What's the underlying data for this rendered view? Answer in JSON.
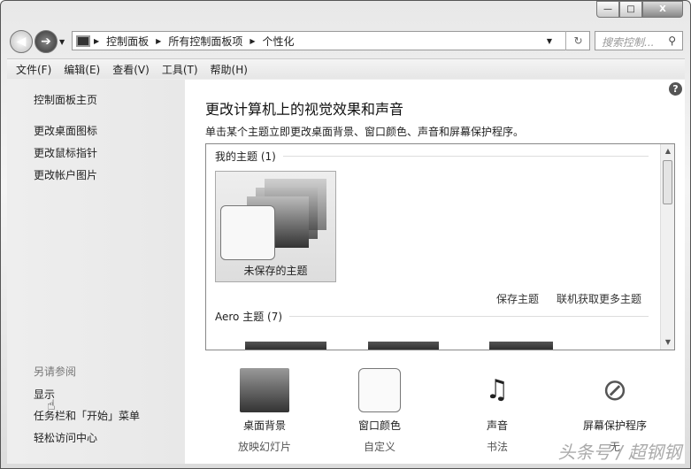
{
  "window": {
    "minimize": "—",
    "maximize": "□",
    "close": "X"
  },
  "address": {
    "crumbs": [
      "控制面板",
      "所有控制面板项",
      "个性化"
    ],
    "search_placeholder": "搜索控制..."
  },
  "menu": [
    "文件(F)",
    "编辑(E)",
    "查看(V)",
    "工具(T)",
    "帮助(H)"
  ],
  "sidebar": {
    "home": "控制面板主页",
    "links": [
      "更改桌面图标",
      "更改鼠标指针",
      "更改帐户图片"
    ],
    "see_also": "另请参阅",
    "see_links": [
      "显示",
      "任务栏和「开始」菜单",
      "轻松访问中心"
    ]
  },
  "main": {
    "title": "更改计算机上的视觉效果和声音",
    "subtitle": "单击某个主题立即更改桌面背景、窗口颜色、声音和屏幕保护程序。",
    "my_themes": "我的主题 (1)",
    "unsaved": "未保存的主题",
    "save_theme": "保存主题",
    "more_themes": "联机获取更多主题",
    "aero": "Aero 主题 (7)"
  },
  "options": [
    {
      "title": "桌面背景",
      "value": "放映幻灯片"
    },
    {
      "title": "窗口颜色",
      "value": "自定义"
    },
    {
      "title": "声音",
      "value": "书法"
    },
    {
      "title": "屏幕保护程序",
      "value": "无"
    }
  ],
  "watermark": "头条号 / 超钢钢"
}
